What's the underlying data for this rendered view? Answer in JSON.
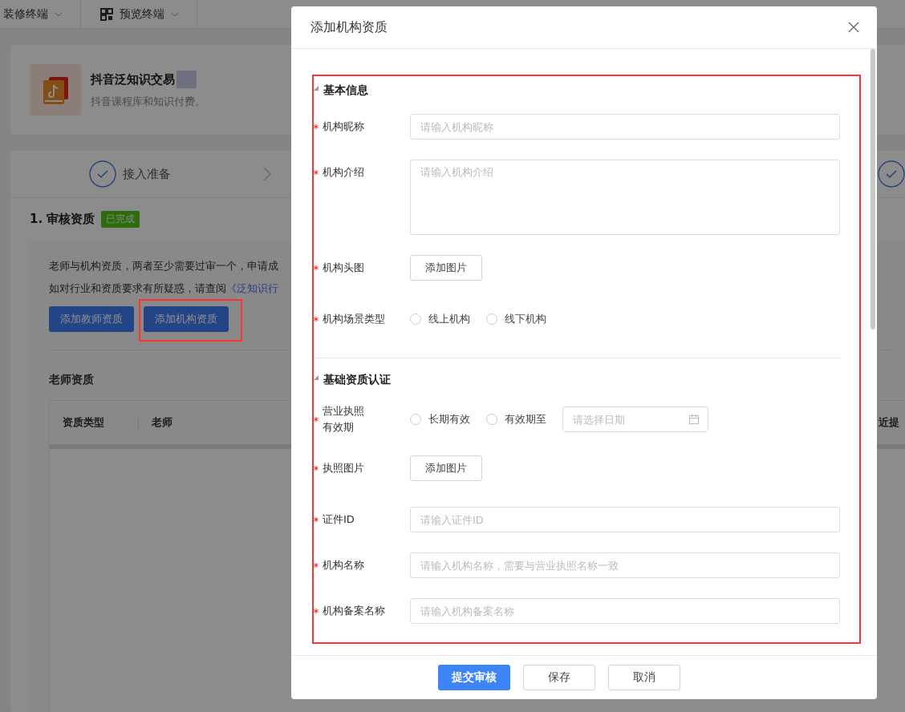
{
  "top_bar": {
    "tabs": [
      {
        "label": "装修终端"
      },
      {
        "label": "预览终端"
      }
    ]
  },
  "product": {
    "title": "抖音泛知识交易",
    "subtitle": "抖音课程库和知识付费。"
  },
  "steps": [
    {
      "label": "接入准备",
      "done": true
    },
    {
      "done": true
    }
  ],
  "review": {
    "title": "1. 审核资质",
    "badge": "已完成",
    "notice": "老师与机构资质，两者至少需要过审一个，申请成",
    "notice2": "如对行业和资质要求有所疑惑，请查阅",
    "link": "《泛知识行",
    "buttons": [
      {
        "label": "添加教师资质"
      },
      {
        "label": "添加机构资质"
      }
    ]
  },
  "teacher_table": {
    "title": "老师资质",
    "columns": [
      "资质类型",
      "老师",
      "近提"
    ]
  },
  "dialog": {
    "title": "添加机构资质",
    "sections": [
      {
        "title": "基本信息",
        "fields": [
          {
            "kind": "input",
            "label": "机构昵称",
            "required": true,
            "placeholder": "请输入机构昵称"
          },
          {
            "kind": "textarea",
            "label": "机构介绍",
            "required": true,
            "placeholder": "请输入机构介绍"
          },
          {
            "kind": "upload",
            "label": "机构头图",
            "required": true,
            "button": "添加图片"
          },
          {
            "kind": "radio",
            "label": "机构场景类型",
            "required": true,
            "options": [
              {
                "label": "线上机构",
                "selected": false
              },
              {
                "label": "线下机构",
                "selected": false
              }
            ]
          }
        ]
      },
      {
        "title": "基础资质认证",
        "fields": [
          {
            "kind": "radio-date",
            "label": "营业执照有效期",
            "required": true,
            "options": [
              {
                "label": "长期有效",
                "selected": false
              },
              {
                "label": "有效期至",
                "selected": false
              }
            ],
            "placeholder": "请选择日期"
          },
          {
            "kind": "upload",
            "label": "执照图片",
            "required": true,
            "button": "添加图片"
          },
          {
            "kind": "input",
            "label": "证件ID",
            "required": true,
            "placeholder": "请输入证件ID"
          },
          {
            "kind": "input",
            "label": "机构名称",
            "required": true,
            "placeholder": "请输入机构名称，需要与营业执照名称一致"
          },
          {
            "kind": "input",
            "label": "机构备案名称",
            "required": true,
            "placeholder": "请输入机构备案名称"
          }
        ]
      }
    ],
    "buttons": [
      {
        "label": "提交审核",
        "primary": true
      },
      {
        "label": "保存",
        "primary": false
      },
      {
        "label": "取消",
        "primary": false
      }
    ]
  }
}
